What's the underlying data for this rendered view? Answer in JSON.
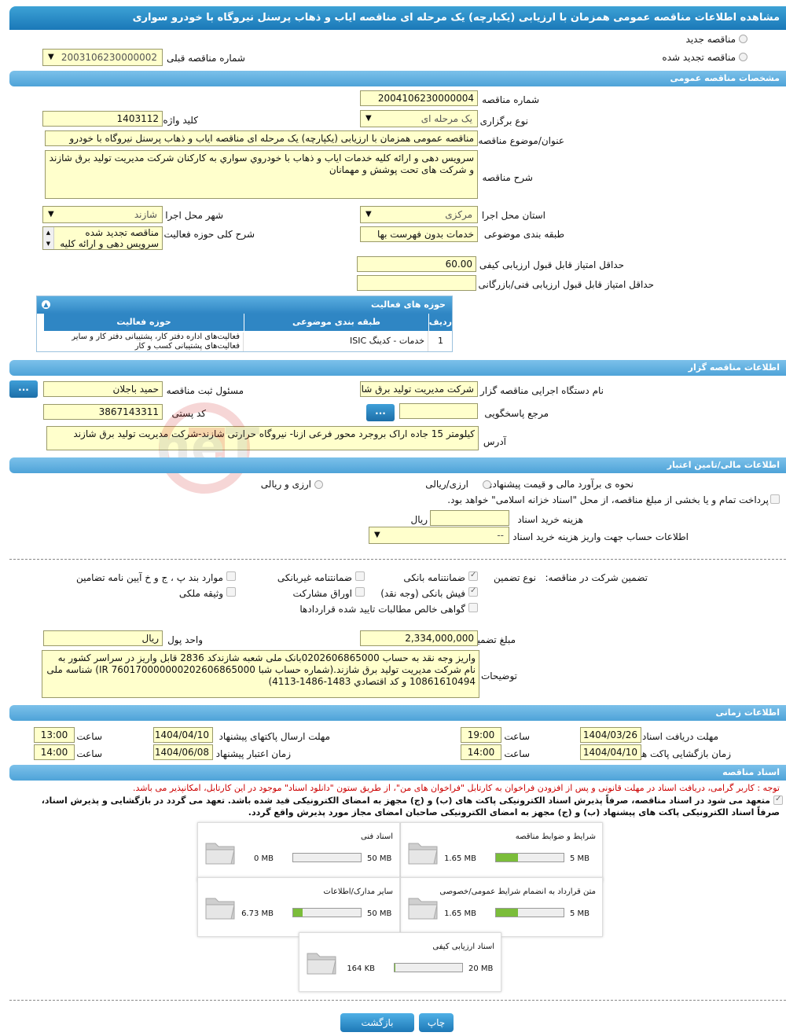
{
  "header": {
    "title": "مشاهده اطلاعات مناقصه عمومی همزمان با ارزیابی (یکپارچه) یک مرحله ای مناقصه ایاب و ذهاب پرسنل نیروگاه با خودرو سواری"
  },
  "top": {
    "radio_new": "مناقصه جدید",
    "radio_renewed": "مناقصه تجدید شده",
    "prev_number_label": "شماره مناقصه قبلی",
    "prev_number_value": "2003106230000002"
  },
  "general": {
    "section_title": "مشخصات مناقصه عمومی",
    "number_label": "شماره مناقصه",
    "number_value": "2004106230000004",
    "type_label": "نوع برگزاری",
    "type_value": "یک مرحله ای",
    "keyword_label": "کلید واژه",
    "keyword_value": "1403112",
    "title_label": "عنوان/موضوع مناقصه",
    "title_value": "مناقصه عمومی همزمان با ارزیابی (یکپارچه) یک مرحله ای مناقصه ایاب و ذهاب پرسنل نیروگاه با خودرو",
    "desc_label": "شرح مناقصه",
    "desc_value": "سرویس دهی و ارائه کلیه خدمات ایاب و ذهاب با خودروي سواري به کارکنان شرکت مدیریت تولید برق شازند و شرکت های تحت پوشش و مهمانان",
    "province_label": "استان محل اجرا",
    "province_value": "مرکزی",
    "city_label": "شهر محل اجرا",
    "city_value": "شازند",
    "category_label": "طبقه بندی موضوعی",
    "category_value": "خدمات بدون فهرست بها",
    "activity_label": "شرح کلی حوزه فعالیت",
    "activity_line1": "مناقصه تجدید شده",
    "activity_line2": "سرویس دهی و ارائه کلیه",
    "min_quality_label": "حداقل امتیاز قابل قبول ارزیابی کیفی",
    "min_quality_value": "60.00",
    "min_tech_label": "حداقل امتیاز قابل قبول ارزیابی فنی/بازرگانی",
    "min_tech_value": ""
  },
  "activity_table": {
    "title": "حوزه های فعالیت",
    "col_row": "ردیف",
    "col_category": "طبقه بندی موضوعی",
    "col_field": "حوزه فعالیت",
    "rows": [
      {
        "row": "1",
        "category": "خدمات - کدینگ ISIC",
        "field": "فعالیت‌های  اداره دفتر کار، پشتیبانی دفتر کار و سایر فعالیت‌های پشتیبانی کسب و کار"
      }
    ]
  },
  "organizer": {
    "section_title": "اطلاعات مناقصه گزار",
    "org_label": "نام دستگاه اجرایی مناقصه گزار",
    "org_value": "شرکت مدیریت تولید برق شازند",
    "responsible_label": "مسئول ثبت مناقصه",
    "responsible_value": "حمید باجلان",
    "ref_label": "مرجع پاسخگویی",
    "ref_value": "",
    "postal_label": "کد پستی",
    "postal_value": "3867143311",
    "address_label": "آدرس",
    "address_value": "کیلومتر 15 جاده اراک بروجرد محور فرعی ازنا- نیروگاه حرارتی شازند-شرکت مدیریت تولید برق شازند",
    "dots": "..."
  },
  "finance": {
    "section_title": "اطلاعات مالی/تامین اعتبار",
    "estimate_label": "نحوه ی برآورد مالی و قیمت پیشنهادی",
    "opt_rial_fx": "ارزی/ریالی",
    "opt_fx_rial": "ارزی و ریالی",
    "payment_text": "پرداخت تمام و یا بخشی از مبلغ مناقصه، از محل \"اسناد خزانه اسلامی\" خواهد بود.",
    "doc_fee_label": "هزینه خرید اسناد",
    "doc_fee_unit": "ریال",
    "doc_fee_value": "",
    "account_label": "اطلاعات حساب جهت واریز هزینه خرید اسناد",
    "account_value": "--"
  },
  "guarantee": {
    "participation_label": "تضمین شرکت در مناقصه:",
    "type_label": "نوع تضمین",
    "bank_guarantee": "ضمانتنامه بانکی",
    "non_bank_guarantee": "ضمانتنامه غیربانکی",
    "regulation_items": "موارد بند پ ، ج و خ آیین نامه تضامین",
    "bank_receipt": "فیش بانکی (وجه نقد)",
    "partnership_bonds": "اوراق مشارکت",
    "property_collateral": "وثیقه ملکی",
    "net_receivables": "گواهی خالص مطالبات تایید شده قراردادها",
    "amount_label": "مبلغ تضمین",
    "amount_value": "2,334,000,000",
    "currency_label": "واحد پول",
    "currency_value": "ریال",
    "notes_label": "توضیحات",
    "notes_value": "واریز وجه نقد  به حساب 0202606865000بانک ملی شعبه شازندکد 2836 قابل واریز در سراسر کشور به نام شرکت مدیریت تولید برق شازند.(شماره حساب شبا  IR 760170000000202606865000) شناسه ملی 10861610494 و کد اقتصادي 1483-1486-4113)"
  },
  "timing": {
    "section_title": "اطلاعات زمانی",
    "doc_deadline_label": "مهلت دریافت اسناد",
    "doc_deadline_date": "1404/03/26",
    "doc_deadline_time": "19:00",
    "send_deadline_label": "مهلت ارسال پاکتهای پیشنهاد",
    "send_deadline_date": "1404/04/10",
    "send_deadline_time": "13:00",
    "opening_label": "زمان بازگشایی پاکت ها",
    "opening_date": "1404/04/10",
    "opening_time": "14:00",
    "validity_label": "زمان اعتبار پیشنهاد",
    "validity_date": "1404/06/08",
    "validity_time": "14:00",
    "time_label": "ساعت"
  },
  "documents": {
    "section_title": "اسناد مناقصه",
    "notice": "توجه : کاربر گرامی، دریافت اسناد در مهلت قانونی و پس از افزودن فراخوان به کارتابل \"فراخوان های من\"، از طریق ستون \"دانلود اسناد\" موجود در این کارتابل، امکانپذیر می باشد.",
    "commit_line1": "متعهد می شود در اسناد مناقصه، صرفاً پذیرش اسناد الکترونیکی پاکت های (ب) و (ج) مجهز به امضای الکترونیکی قید شده باشد. تعهد می گردد در بازگشایی و پذیرش اسناد،",
    "commit_line2": "صرفاً اسناد الکترونیکی پاکت های پیشنهاد (ب) و (ج) مجهز به امضای الکترونیکی صاحبان امضای مجاز مورد پذیرش واقع گردد.",
    "cards": [
      {
        "title": "شرایط و ضوابط مناقصه",
        "used": "1.65 MB",
        "max": "5 MB",
        "fill": 0.33
      },
      {
        "title": "اسناد فنی",
        "used": "0 MB",
        "max": "50 MB",
        "fill": 0.0
      },
      {
        "title": "متن قرارداد به انضمام شرایط عمومی/خصوصی",
        "used": "1.65 MB",
        "max": "5 MB",
        "fill": 0.33
      },
      {
        "title": "سایر مدارک/اطلاعات",
        "used": "6.73 MB",
        "max": "50 MB",
        "fill": 0.14
      },
      {
        "title": "اسناد ارزیابی کیفی",
        "used": "164 KB",
        "max": "20 MB",
        "fill": 0.01
      }
    ]
  },
  "footer": {
    "print": "چاپ",
    "back": "بازگشت"
  },
  "watermark": {
    "text": "AriaTender.neT"
  },
  "colors": {
    "header": "#1a78b8",
    "section": "#4ea3d8",
    "field": "#ffffcc",
    "progress": "#7bbd3a"
  }
}
